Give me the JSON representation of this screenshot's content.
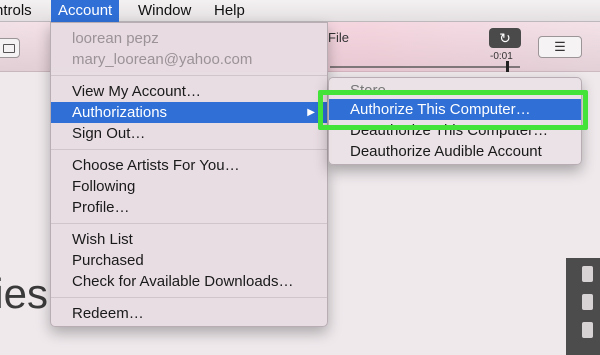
{
  "menubar": {
    "items": [
      {
        "label": "ntrols"
      },
      {
        "label": "Account"
      },
      {
        "label": "Window"
      },
      {
        "label": "Help"
      }
    ]
  },
  "toolbar": {
    "now_playing_title": "File",
    "repeat_icon": "↻",
    "remaining_time": "-0:01",
    "list_icon": "☰"
  },
  "background": {
    "heading": "vies"
  },
  "account_menu": {
    "user_name": "loorean pepz",
    "user_email": "mary_loorean@yahoo.com",
    "view_account": "View My Account…",
    "authorizations": "Authorizations",
    "submenu_arrow": "▶",
    "sign_out": "Sign Out…",
    "choose_artists": "Choose Artists For You…",
    "following": "Following",
    "profile": "Profile…",
    "wish_list": "Wish List",
    "purchased": "Purchased",
    "check_downloads": "Check for Available Downloads…",
    "redeem": "Redeem…"
  },
  "auth_submenu": {
    "store": "Store",
    "authorize_computer": "Authorize This Computer…",
    "deauthorize_computer": "Deauthorize This Computer…",
    "deauthorize_audible": "Deauthorize Audible Account"
  },
  "colors": {
    "menu_highlight": "#2f6fd6",
    "callout_green": "#44e33a"
  }
}
